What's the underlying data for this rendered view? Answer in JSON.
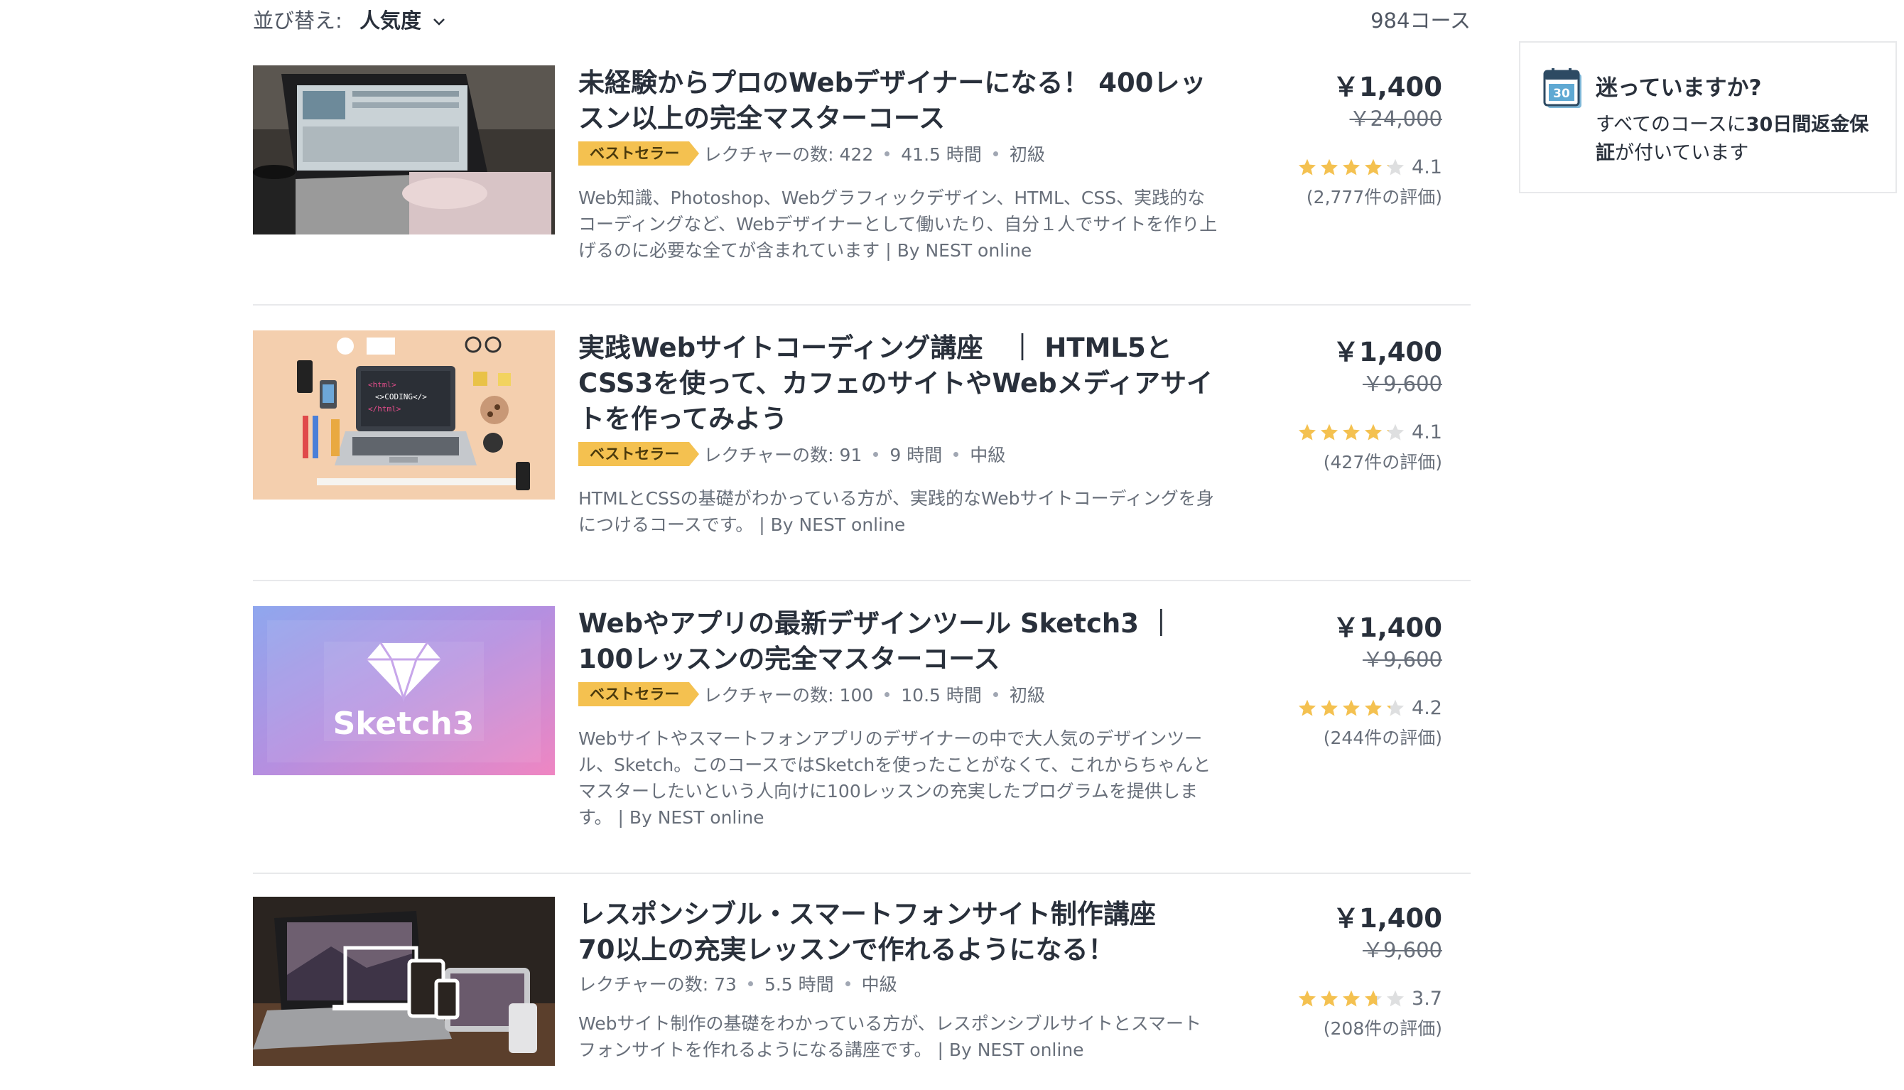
{
  "sort": {
    "label": "並び替え:",
    "value": "人気度"
  },
  "course_count": "984コース",
  "courses": [
    {
      "title": "未経験からプロのWebデザイナーになる！ 400レッスン以上の完全マスターコース",
      "badge": "ベストセラー",
      "lectures": "レクチャーの数: 422",
      "hours": "41.5 時間",
      "level": "初級",
      "description": "Web知識、Photoshop、Webグラフィックデザイン、HTML、CSS、実践的なコーディングなど、Webデザイナーとして働いたり、自分１人でサイトを作り上げるのに必要な全てが含まれています | By NEST online",
      "price": "￥1,400",
      "old_price": "￥24,000",
      "rating": "4.1",
      "rating_value": 4.1,
      "reviews": "(2,777件の評価)"
    },
    {
      "title": "実践Webサイトコーディング講座　｜ HTML5とCSS3を使って、カフェのサイトやWebメディアサイトを作ってみよう",
      "badge": "ベストセラー",
      "lectures": "レクチャーの数: 91",
      "hours": "9 時間",
      "level": "中級",
      "description": "HTMLとCSSの基礎がわかっている方が、実践的なWebサイトコーディングを身につけるコースです。 | By NEST online",
      "price": "￥1,400",
      "old_price": "￥9,600",
      "rating": "4.1",
      "rating_value": 4.1,
      "reviews": "(427件の評価)"
    },
    {
      "title": "Webやアプリの最新デザインツール Sketch3 ｜100レッスンの完全マスターコース",
      "badge": "ベストセラー",
      "lectures": "レクチャーの数: 100",
      "hours": "10.5 時間",
      "level": "初級",
      "description": "Webサイトやスマートフォンアプリのデザイナーの中で大人気のデザインツール、Sketch。このコースではSketchを使ったことがなくて、これからちゃんとマスターしたいという人向けに100レッスンの充実したプログラムを提供します。 | By NEST online",
      "price": "￥1,400",
      "old_price": "￥9,600",
      "rating": "4.2",
      "rating_value": 4.2,
      "reviews": "(244件の評価)",
      "thumb_text": "Sketch3"
    },
    {
      "title": "レスポンシブル・スマートフォンサイト制作講座　70以上の充実レッスンで作れるようになる！",
      "badge": "",
      "lectures": "レクチャーの数: 73",
      "hours": "5.5 時間",
      "level": "中級",
      "description": "Webサイト制作の基礎をわかっている方が、レスポンシブルサイトとスマートフォンサイトを作れるようになる講座です。 | By NEST online",
      "price": "￥1,400",
      "old_price": "￥9,600",
      "rating": "3.7",
      "rating_value": 3.7,
      "reviews": "(208件の評価)"
    }
  ],
  "thumb2_text": [
    "<html>",
    "<>CODING</>",
    "</html>"
  ],
  "sidebar": {
    "calendar_number": "30",
    "heading": "迷っていますか?",
    "body_pre": "すべてのコースに",
    "body_strong": "30日間返金保証",
    "body_post": "が付いています"
  },
  "colors": {
    "star": "#f4c150",
    "star_empty": "#dedfe0",
    "badge": "#f4c150"
  }
}
